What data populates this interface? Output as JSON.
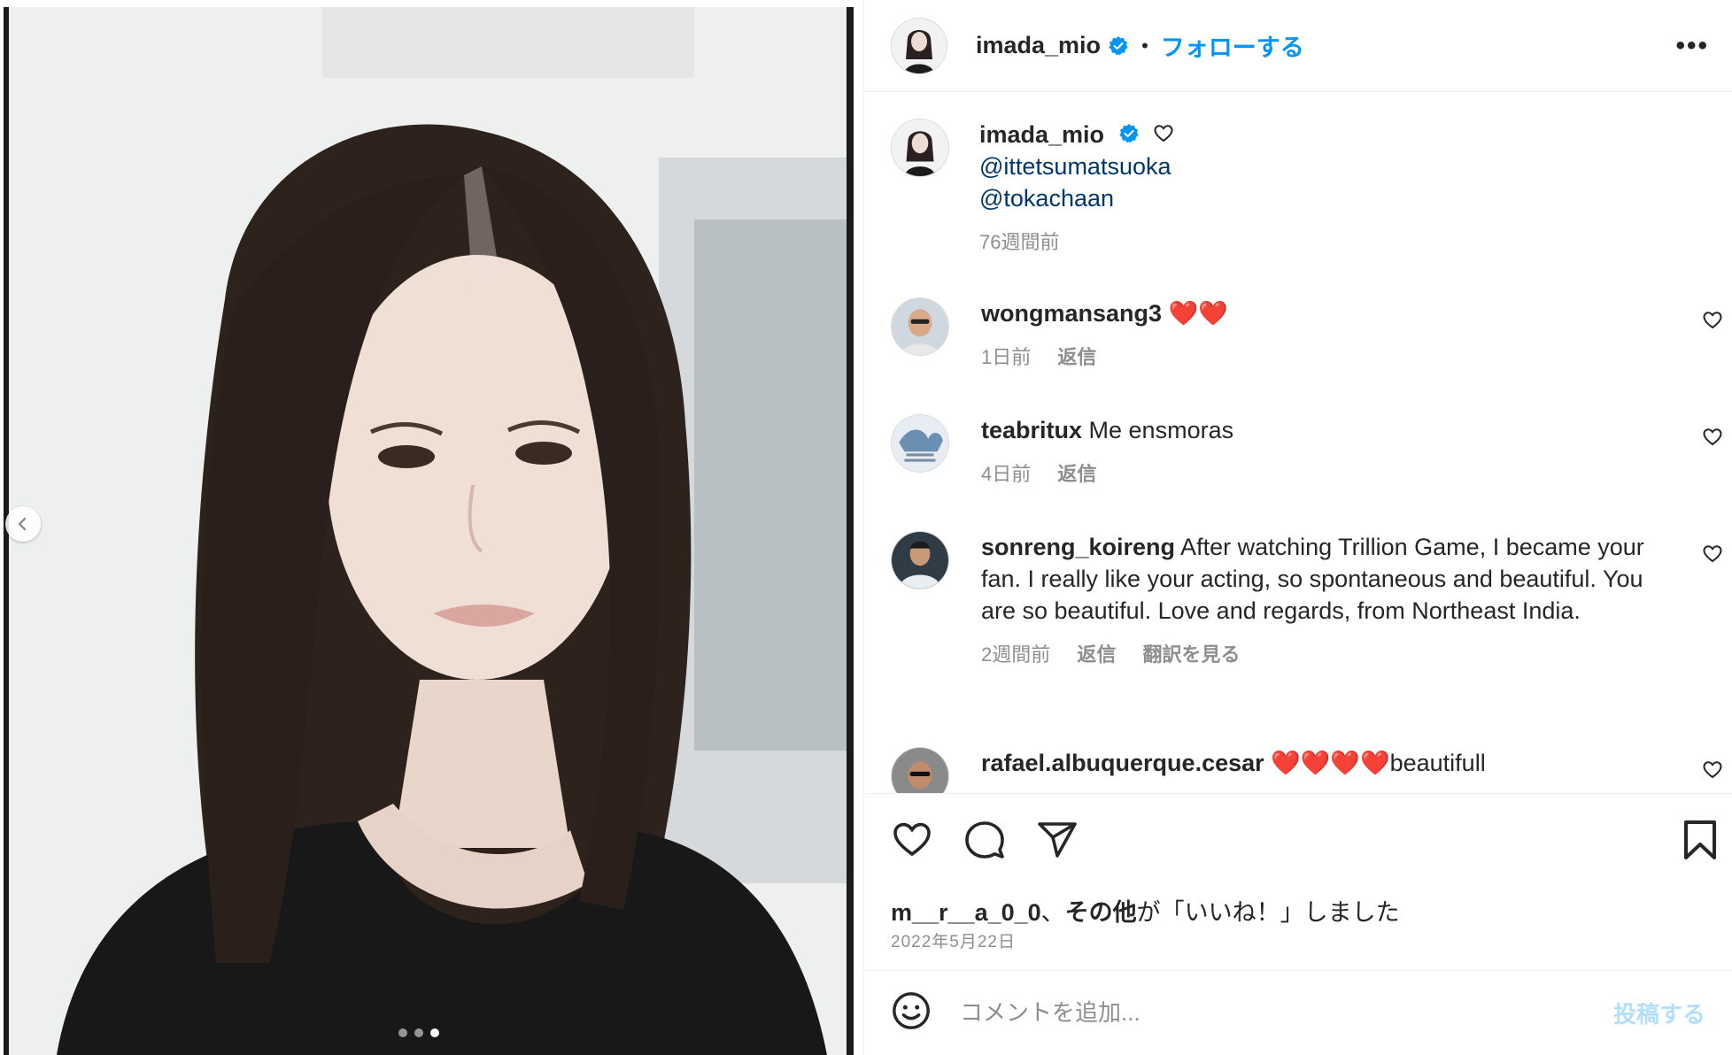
{
  "post": {
    "carousel_total": 3,
    "carousel_active": 3
  },
  "header": {
    "username": "imada_mio",
    "separator": "•",
    "follow_label": "フォローする",
    "more_label": "•••"
  },
  "caption": {
    "username": "imada_mio",
    "mention_1": "@ittetsumatsuoka",
    "mention_2": "@tokachaan",
    "time": "76週間前"
  },
  "comments": [
    {
      "username": "wongmansang3",
      "text": " ❤️❤️",
      "time": "1日前",
      "reply": "返信"
    },
    {
      "username": "teabritux",
      "text": " Me ensmoras",
      "time": "4日前",
      "reply": "返信"
    },
    {
      "username": "sonreng_koireng",
      "text": " After watching Trillion Game, I became your fan. I really like your acting, so spontaneous and beautiful. You are so beautiful. Love and regards, from Northeast India.",
      "time": "2週間前",
      "reply": "返信",
      "translate": "翻訳を見る"
    },
    {
      "username": "rafael.albuquerque.cesar",
      "text": " ❤️❤️❤️❤️beautifull"
    }
  ],
  "likes": {
    "user": "m__r__a_0_0",
    "sep": "、",
    "others": "その他",
    "suffix": "が「いいね！」しました"
  },
  "date": "2022年5月22日",
  "comment_box": {
    "placeholder": "コメントを追加...",
    "post_label": "投稿する"
  },
  "colors": {
    "accent": "#0095f6",
    "mention": "#00376b",
    "muted": "#8e8e8e",
    "post_disabled": "#b2dffc"
  },
  "icons": {
    "verified": "verified-badge-icon",
    "like": "heart-icon",
    "comment": "comment-bubble-icon",
    "share": "paper-plane-icon",
    "save": "bookmark-icon",
    "emoji": "smiley-icon",
    "prev": "chevron-left-icon"
  }
}
